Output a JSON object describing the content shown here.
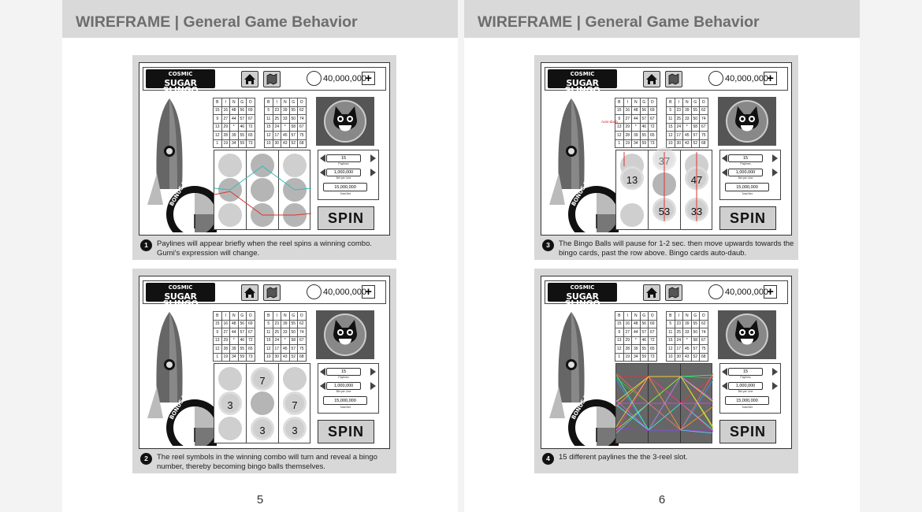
{
  "pages": [
    {
      "header": "WIREFRAME | General Game Behavior",
      "page_number": "5",
      "frames": [
        {
          "step": "1",
          "caption": "Paylines will appear briefly when the reel spins a winning combo. Gumi's expression will change."
        },
        {
          "step": "2",
          "caption": "The reel symbols in the winning combo will turn and reveal a bingo number, thereby becoming bingo balls themselves."
        }
      ]
    },
    {
      "header": "WIREFRAME | General Game Behavior",
      "page_number": "6",
      "frames": [
        {
          "step": "3",
          "caption": "The Bingo Balls will pause for 1-2 sec. then move upwards towards the bingo cards, past the row above. Bingo cards auto-daub."
        },
        {
          "step": "4",
          "caption": "15 different paylines the the 3-reel slot."
        }
      ]
    }
  ],
  "game": {
    "logo_line1": "COSMIC",
    "logo_line2": "SUGAR SLINGO",
    "coins": "40,000,000",
    "plus": "+",
    "paylines_value": "15",
    "paylines_label": "Paylines",
    "bet_value": "1,000,000",
    "bet_label": "Bet per Line",
    "total_value": "15,000,000",
    "total_label": "Total Bet",
    "spin_label": "SPIN",
    "bonus_meter": "BONUS METER",
    "autodaub_label": "Auto-daub"
  },
  "bingo_headers": [
    "B",
    "I",
    "N",
    "G",
    "O"
  ],
  "card1": [
    [
      "15",
      "16",
      "48",
      "56",
      "69"
    ],
    [
      "9",
      "27",
      "44",
      "57",
      "67"
    ],
    [
      "13",
      "29",
      "*",
      "46",
      "72"
    ],
    [
      "12",
      "28",
      "39",
      "55",
      "65"
    ],
    [
      "1",
      "19",
      "34",
      "59",
      "73"
    ]
  ],
  "card2": [
    [
      "5",
      "23",
      "39",
      "55",
      "62"
    ],
    [
      "11",
      "25",
      "33",
      "50",
      "74"
    ],
    [
      "15",
      "24",
      "*",
      "58",
      "67"
    ],
    [
      "12",
      "17",
      "45",
      "57",
      "75"
    ],
    [
      "10",
      "30",
      "43",
      "52",
      "68"
    ]
  ],
  "frame2_reel_numbers": [
    "7",
    "3",
    "7",
    "3",
    "3"
  ],
  "frame3_reel_numbers": [
    "37",
    "13",
    "47",
    "53",
    "33"
  ],
  "colors": {
    "header_bg": "#d9d9d9",
    "header_text": "#6d6d6d",
    "frame_bg": "#d8d8d8",
    "payline_red": "#d33",
    "payline_teal": "#3bb"
  }
}
